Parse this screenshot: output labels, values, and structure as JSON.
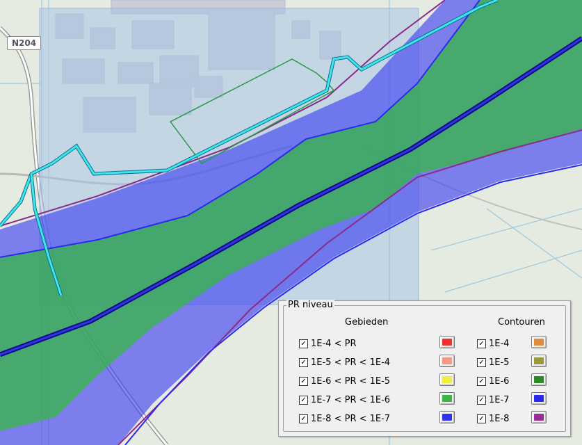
{
  "map": {
    "road_label": "N204"
  },
  "legend": {
    "title": "PR niveau",
    "areas_header": "Gebieden",
    "contours_header": "Contouren",
    "areas": [
      {
        "label": "1E-4 < PR",
        "checked": true,
        "color": "#ee3333"
      },
      {
        "label": "1E-5 < PR < 1E-4",
        "checked": true,
        "color": "#f49a80"
      },
      {
        "label": "1E-6 < PR < 1E-5",
        "checked": true,
        "color": "#f2ee3c"
      },
      {
        "label": "1E-7 < PR < 1E-6",
        "checked": true,
        "color": "#3cb544"
      },
      {
        "label": "1E-8 < PR < 1E-7",
        "checked": true,
        "color": "#3333ee"
      }
    ],
    "contours": [
      {
        "label": "1E-4",
        "checked": true,
        "color": "#e08a3c"
      },
      {
        "label": "1E-5",
        "checked": true,
        "color": "#9a9a3a"
      },
      {
        "label": "1E-6",
        "checked": true,
        "color": "#2a8a2a"
      },
      {
        "label": "1E-7",
        "checked": true,
        "color": "#2a2aee"
      },
      {
        "label": "1E-8",
        "checked": true,
        "color": "#9a2a9a"
      }
    ]
  }
}
